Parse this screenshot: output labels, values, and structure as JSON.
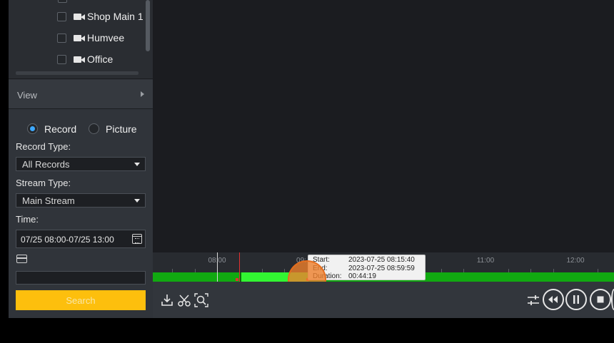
{
  "camera_list": {
    "items": [
      {
        "label": "Shop Main 1",
        "checked": false
      },
      {
        "label": "Humvee",
        "checked": false
      },
      {
        "label": "Office",
        "checked": false
      }
    ]
  },
  "view": {
    "label": "View"
  },
  "record_mode": {
    "record_label": "Record",
    "picture_label": "Picture",
    "selected": "Record"
  },
  "record_type": {
    "label": "Record Type:",
    "value": "All Records"
  },
  "stream_type": {
    "label": "Stream Type:",
    "value": "Main Stream"
  },
  "time": {
    "label": "Time:",
    "value": "07/25 08:00-07/25 13:00"
  },
  "card": {
    "value": ""
  },
  "search_button": {
    "label": "Search"
  },
  "timeline": {
    "ticks": [
      "08:00",
      "09:",
      "11:00",
      "12:00"
    ]
  },
  "tooltip": {
    "start_key": "Start:",
    "start_value": "2023-07-25 08:15:40",
    "end_key": "End:",
    "end_value": "2023-07-25 08:59:59",
    "duration_key": "Duration:",
    "duration_value": "00:44:19"
  },
  "colors": {
    "accent": "#fdbf0d",
    "record_track": "#11a911",
    "selected_segment": "#32f532",
    "radio_selected": "#3da8ff"
  },
  "icons": {
    "toolbar_left": [
      "download-icon",
      "scissors-icon",
      "zoom-search-icon"
    ],
    "toolbar_right": [
      "adjust-icon",
      "rewind-icon",
      "pause-icon",
      "stop-icon"
    ]
  }
}
